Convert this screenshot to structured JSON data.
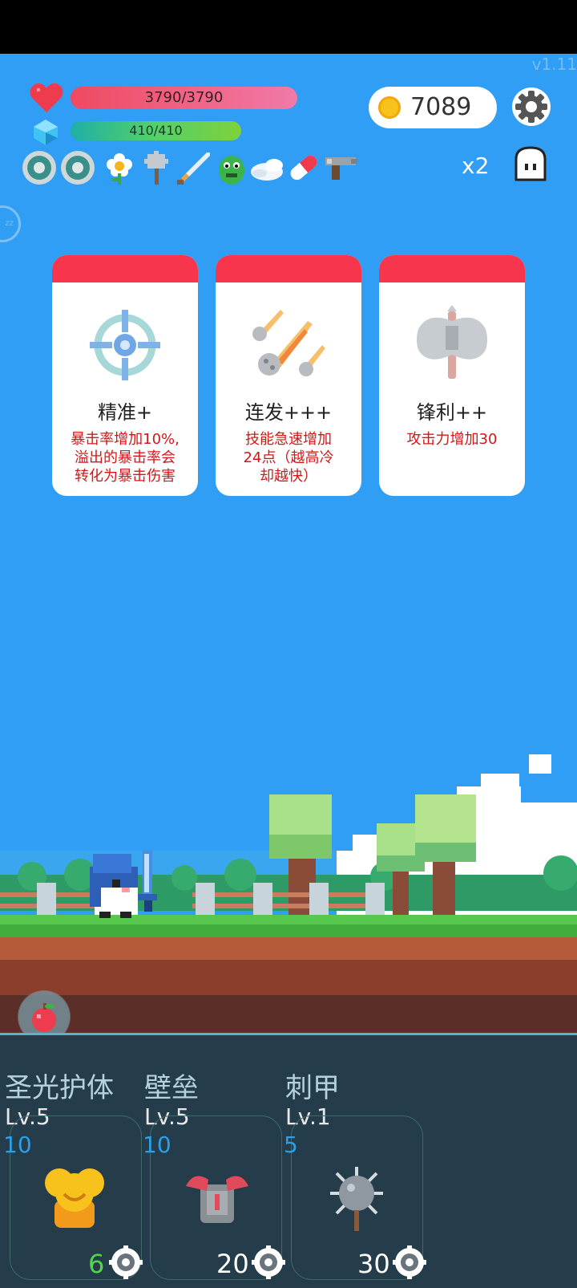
{
  "version": "v1.11",
  "hud": {
    "hp_text": "3790/3790",
    "hp_fraction": 1.0,
    "mp_text": "410/410",
    "mp_fraction": 1.0,
    "coins": "7089",
    "multiplier": "x2"
  },
  "equipped_items": [
    {
      "icon": "ring-shield-icon"
    },
    {
      "icon": "ring-shield-icon"
    },
    {
      "icon": "flower-icon"
    },
    {
      "icon": "spiked-mace-icon"
    },
    {
      "icon": "sword-icon"
    },
    {
      "icon": "green-monster-icon"
    },
    {
      "icon": "wing-icon"
    },
    {
      "icon": "pill-capsule-icon"
    },
    {
      "icon": "blaster-gun-icon"
    }
  ],
  "upgrade_cards": [
    {
      "title": "精准+",
      "desc_lines": [
        "暴击率增加10%,",
        "溢出的暴击率会",
        "转化为暴击伤害"
      ],
      "icon": "crosshair-icon"
    },
    {
      "title": "连发+++",
      "desc_lines": [
        "技能急速增加",
        "24点（越高冷",
        "却越快）"
      ],
      "icon": "meteor-icon"
    },
    {
      "title": "锋利++",
      "desc_lines": [
        "攻击力增加30"
      ],
      "icon": "battle-axe-icon"
    }
  ],
  "skills": [
    {
      "name": "圣光护体",
      "level": "Lv.5",
      "value": "10",
      "upgrade_cost": "6",
      "icon": "holy-shield-icon"
    },
    {
      "name": "壁垒",
      "level": "Lv.5",
      "value": "10",
      "upgrade_cost": "20",
      "icon": "armor-icon"
    },
    {
      "name": "刺甲",
      "level": "Lv.1",
      "value": "5",
      "upgrade_cost": "30",
      "icon": "spiked-ball-icon"
    }
  ],
  "colors": {
    "sky": "#2f9ef4",
    "card_cap": "#f7364e",
    "card_desc": "#d01818",
    "panel": "#253c4a"
  }
}
